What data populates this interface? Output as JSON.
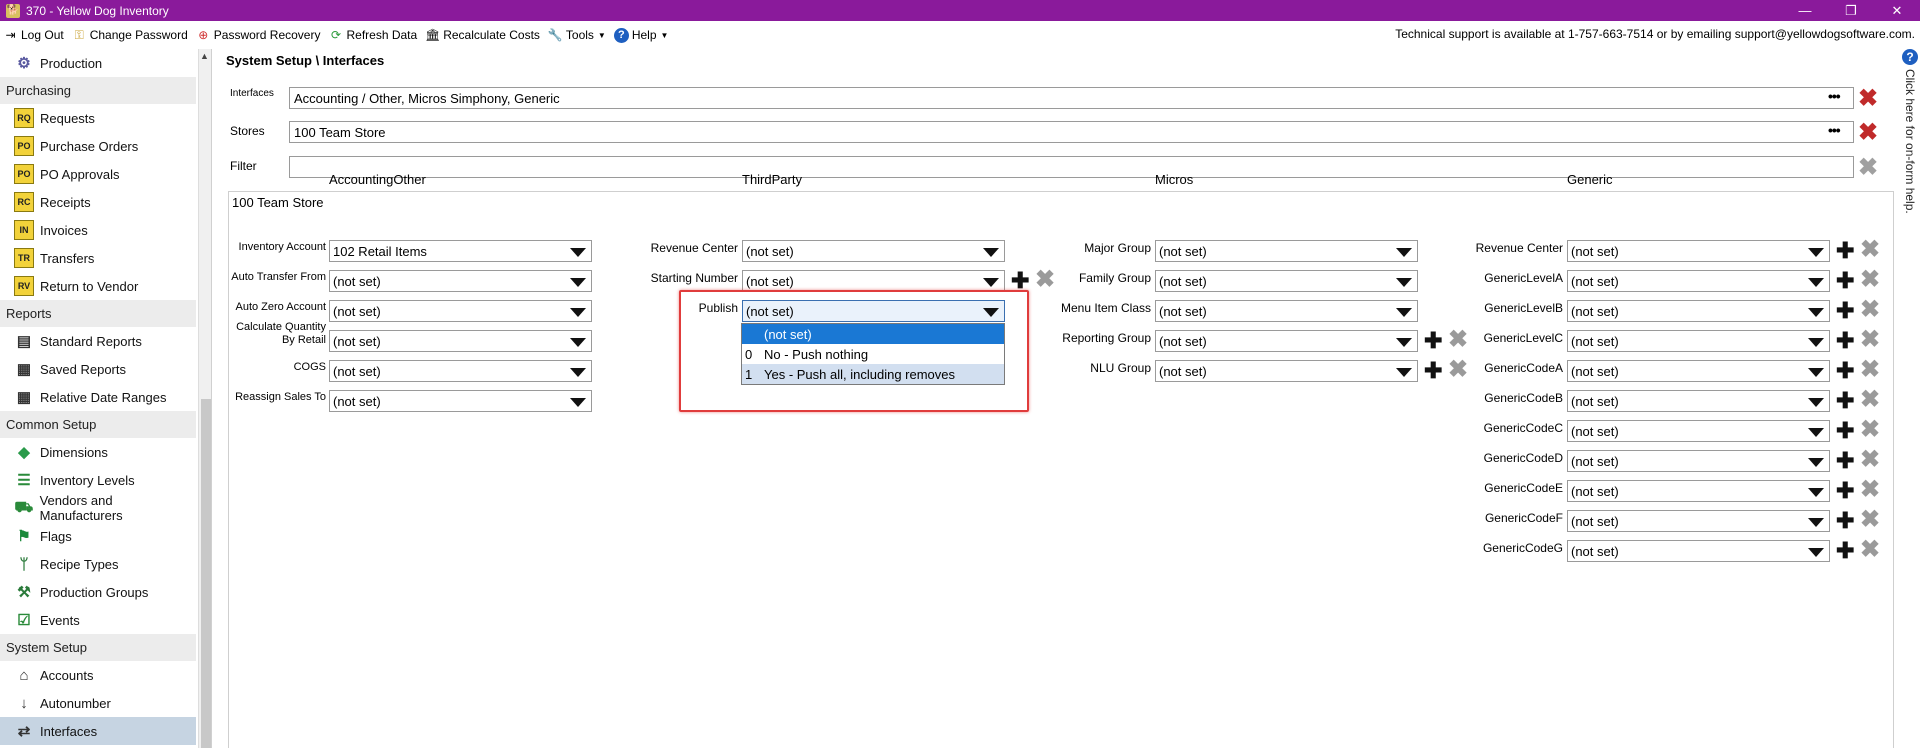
{
  "window": {
    "title": "370  - Yellow Dog Inventory",
    "minimize": "—",
    "restore": "❐",
    "close": "✕"
  },
  "menu": {
    "items": [
      {
        "label": "Log Out",
        "icon": "logout-icon"
      },
      {
        "label": "Change Password",
        "icon": "key-icon"
      },
      {
        "label": "Password Recovery",
        "icon": "lifebuoy-icon"
      },
      {
        "label": "Refresh Data",
        "icon": "refresh-icon"
      },
      {
        "label": "Recalculate Costs",
        "icon": "bank-icon"
      },
      {
        "label": "Tools",
        "icon": "wrench-icon"
      },
      {
        "label": "Help",
        "icon": "help-icon"
      }
    ],
    "support": "Technical support is available at 1-757-663-7514 or by emailing support@yellowdogsoftware.com."
  },
  "sidebar": {
    "rows": [
      {
        "kind": "item",
        "label": "Production",
        "icon": "production-icon"
      },
      {
        "kind": "section",
        "label": "Purchasing"
      },
      {
        "kind": "item",
        "label": "Requests",
        "icon": "rq-doc-icon",
        "code": "RQ"
      },
      {
        "kind": "item",
        "label": "Purchase Orders",
        "icon": "po-doc-icon",
        "code": "PO"
      },
      {
        "kind": "item",
        "label": "PO Approvals",
        "icon": "po-approval-icon",
        "code": "PO"
      },
      {
        "kind": "item",
        "label": "Receipts",
        "icon": "rc-doc-icon",
        "code": "RC"
      },
      {
        "kind": "item",
        "label": "Invoices",
        "icon": "in-doc-icon",
        "code": "IN"
      },
      {
        "kind": "item",
        "label": "Transfers",
        "icon": "tr-doc-icon",
        "code": "TR"
      },
      {
        "kind": "item",
        "label": "Return to Vendor",
        "icon": "rv-doc-icon",
        "code": "RV"
      },
      {
        "kind": "section",
        "label": "Reports"
      },
      {
        "kind": "item",
        "label": "Standard Reports",
        "icon": "report-icon"
      },
      {
        "kind": "item",
        "label": "Saved Reports",
        "icon": "saved-report-icon"
      },
      {
        "kind": "item",
        "label": "Relative Date Ranges",
        "icon": "calendar-icon"
      },
      {
        "kind": "section",
        "label": "Common Setup"
      },
      {
        "kind": "item",
        "label": "Dimensions",
        "icon": "cube-icon"
      },
      {
        "kind": "item",
        "label": "Inventory Levels",
        "icon": "levels-icon"
      },
      {
        "kind": "item",
        "label": "Vendors and Manufacturers",
        "icon": "truck-icon"
      },
      {
        "kind": "item",
        "label": "Flags",
        "icon": "flag-icon"
      },
      {
        "kind": "item",
        "label": "Recipe Types",
        "icon": "utensils-icon"
      },
      {
        "kind": "item",
        "label": "Production Groups",
        "icon": "hammer-icon"
      },
      {
        "kind": "item",
        "label": "Events",
        "icon": "event-check-icon"
      },
      {
        "kind": "section",
        "label": "System Setup"
      },
      {
        "kind": "item",
        "label": "Accounts",
        "icon": "bank-icon"
      },
      {
        "kind": "item",
        "label": "Autonumber",
        "icon": "sort-numeric-icon"
      },
      {
        "kind": "item",
        "label": "Interfaces",
        "icon": "swap-arrows-icon",
        "active": true
      }
    ]
  },
  "breadcrumb": "System Setup \\ Interfaces",
  "filters": {
    "interfaces_label": "Interfaces",
    "interfaces_value": "Accounting / Other, Micros Simphony, Generic",
    "stores_label": "Stores",
    "stores_value": "100 Team Store",
    "filter_label": "Filter",
    "filter_value": "",
    "ellipsis": "•••",
    "remove": "✖"
  },
  "store": {
    "title": "100 Team Store",
    "accounting": {
      "header": "AccountingOther",
      "fields": [
        {
          "label": "Inventory Account",
          "value": "102 Retail Items"
        },
        {
          "label": "Auto Transfer From",
          "value": "(not set)"
        },
        {
          "label": "Auto Zero Account",
          "value": "(not set)"
        },
        {
          "label": "Calculate Quantity By Retail",
          "value": "(not set)"
        },
        {
          "label": "COGS",
          "value": "(not set)"
        },
        {
          "label": "Reassign Sales To",
          "value": "(not set)"
        }
      ]
    },
    "thirdparty": {
      "header": "ThirdParty",
      "fields": [
        {
          "label": "Revenue Center",
          "value": "(not set)"
        },
        {
          "label": "Starting Number",
          "value": "(not set)"
        },
        {
          "label": "Publish",
          "value": "(not set)"
        }
      ],
      "publish_options": [
        {
          "code": "",
          "label": "(not set)"
        },
        {
          "code": "0",
          "label": "No - Push nothing"
        },
        {
          "code": "1",
          "label": "Yes - Push all, including removes"
        }
      ]
    },
    "micros": {
      "header": "Micros",
      "fields": [
        {
          "label": "Major Group",
          "value": "(not set)"
        },
        {
          "label": "Family Group",
          "value": "(not set)"
        },
        {
          "label": "Menu Item Class",
          "value": "(not set)"
        },
        {
          "label": "Reporting Group",
          "value": "(not set)"
        },
        {
          "label": "NLU Group",
          "value": "(not set)"
        }
      ]
    },
    "generic": {
      "header": "Generic",
      "fields": [
        {
          "label": "Revenue Center",
          "value": "(not set)"
        },
        {
          "label": "GenericLevelA",
          "value": "(not set)"
        },
        {
          "label": "GenericLevelB",
          "value": "(not set)"
        },
        {
          "label": "GenericLevelC",
          "value": "(not set)"
        },
        {
          "label": "GenericCodeA",
          "value": "(not set)"
        },
        {
          "label": "GenericCodeB",
          "value": "(not set)"
        },
        {
          "label": "GenericCodeC",
          "value": "(not set)"
        },
        {
          "label": "GenericCodeD",
          "value": "(not set)"
        },
        {
          "label": "GenericCodeE",
          "value": "(not set)"
        },
        {
          "label": "GenericCodeF",
          "value": "(not set)"
        },
        {
          "label": "GenericCodeG",
          "value": "(not set)"
        }
      ]
    },
    "plus": "✚",
    "cross": "✖"
  },
  "help_tab": {
    "icon": "?",
    "text": "Click here for on-form help."
  }
}
